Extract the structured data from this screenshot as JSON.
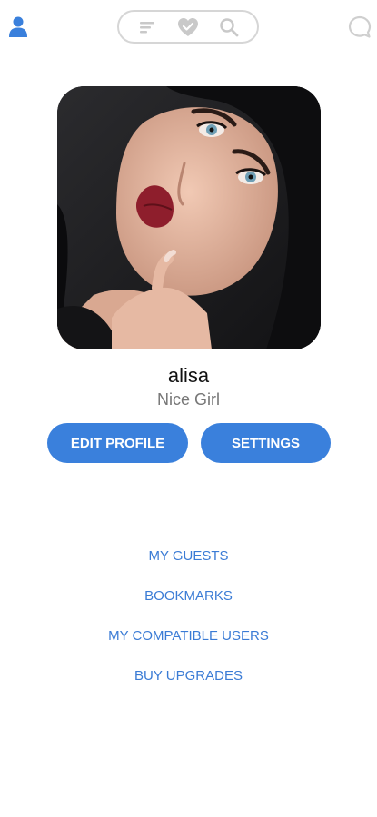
{
  "profile": {
    "name": "alisa",
    "status": "Nice Girl"
  },
  "actions": {
    "edit_label": "EDIT PROFILE",
    "settings_label": "SETTINGS"
  },
  "links": [
    {
      "label": "MY GUESTS"
    },
    {
      "label": "BOOKMARKS"
    },
    {
      "label": "MY COMPATIBLE USERS"
    },
    {
      "label": "BUY UPGRADES"
    }
  ],
  "icons": {
    "profile": "person-icon",
    "filter": "filter-icon",
    "likes": "heart-icon",
    "search": "search-icon",
    "chat": "chat-bubble-icon"
  },
  "colors": {
    "accent": "#3a80dc",
    "link": "#3a7bd5",
    "name": "#111111",
    "status": "#777777"
  }
}
